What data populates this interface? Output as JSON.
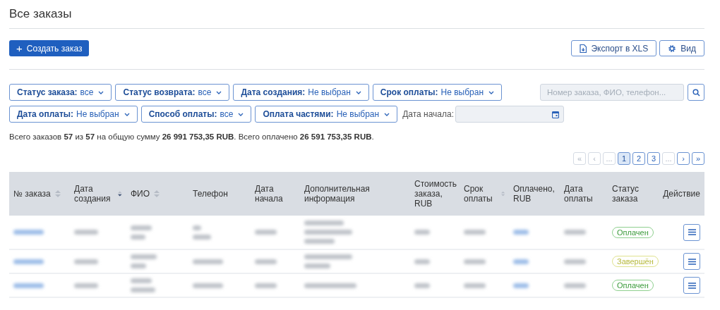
{
  "page_title": "Все заказы",
  "create_button": {
    "label": "Создать заказ",
    "icon": "+"
  },
  "toolbar_buttons": [
    {
      "label": "Экспорт в XLS",
      "kind": "export"
    },
    {
      "label": "Вид",
      "kind": "view"
    }
  ],
  "filters": [
    {
      "label": "Статус заказа:",
      "value": "все"
    },
    {
      "label": "Статус возврата:",
      "value": "все"
    },
    {
      "label": "Дата создания:",
      "value": "Не выбран"
    },
    {
      "label": "Срок оплаты:",
      "value": "Не выбран"
    },
    {
      "label": "Дата оплаты:",
      "value": "Не выбран"
    },
    {
      "label": "Способ оплаты:",
      "value": "все"
    },
    {
      "label": "Оплата частями:",
      "value": "Не выбран"
    }
  ],
  "start_date": {
    "label": "Дата начала:"
  },
  "search": {
    "placeholder": "Номер заказа, ФИО, телефон..."
  },
  "summary": "Всего заказов **57** из **57** на общую сумму **26 991 753,35 RUB**. Всего оплачено **26 591 753,35 RUB**.",
  "pagination": [
    {
      "label": "«",
      "disabled": true,
      "selected": false
    },
    {
      "label": "‹",
      "disabled": true,
      "selected": false
    },
    {
      "label": "...",
      "disabled": true,
      "selected": false
    },
    {
      "label": "1",
      "disabled": false,
      "selected": true
    },
    {
      "label": "2",
      "disabled": false,
      "selected": false
    },
    {
      "label": "3",
      "disabled": false,
      "selected": false
    },
    {
      "label": "...",
      "disabled": true,
      "selected": false
    },
    {
      "label": "›",
      "disabled": false,
      "selected": false
    },
    {
      "label": "»",
      "disabled": false,
      "selected": false
    }
  ],
  "table": {
    "columns": [
      {
        "label": "№ заказа",
        "sortable": true,
        "sorted": false
      },
      {
        "label": "Дата создания",
        "sortable": true,
        "sorted": true
      },
      {
        "label": "ФИО",
        "sortable": true,
        "sorted": false
      },
      {
        "label": "Телефон",
        "sortable": false
      },
      {
        "label": "Дата начала",
        "sortable": false
      },
      {
        "label": "Дополнительная информация",
        "sortable": false
      },
      {
        "label": "Стоимость заказа, RUB",
        "sortable": false
      },
      {
        "label": "Срок оплаты",
        "sortable": true,
        "sorted": false
      },
      {
        "label": "Оплачено, RUB",
        "sortable": false
      },
      {
        "label": "Дата оплаты",
        "sortable": false
      },
      {
        "label": "Статус заказа",
        "sortable": false
      },
      {
        "label": "Действие",
        "sortable": false
      }
    ],
    "rows": [
      {
        "status": {
          "label": "Оплачен",
          "kind": "paid"
        }
      },
      {
        "status": {
          "label": "Завершён",
          "kind": "done"
        }
      },
      {
        "status": {
          "label": "Оплачен",
          "kind": "paid"
        }
      }
    ]
  }
}
